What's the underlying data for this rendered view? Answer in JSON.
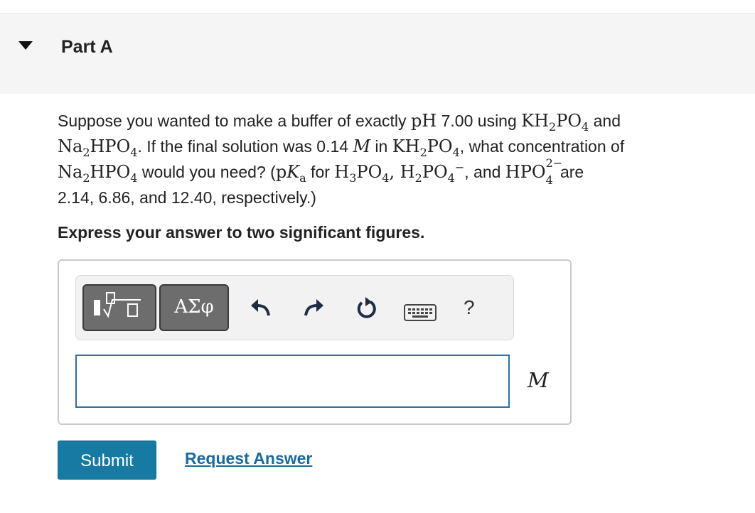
{
  "part": {
    "title": "Part A"
  },
  "question": {
    "t1": "Suppose you wanted to make a buffer of exactly ",
    "pH": "pH",
    "t2": " 7.00 using ",
    "kh2po4_a": "KH",
    "kh2po4_b": "2",
    "kh2po4_c": "PO",
    "kh2po4_d": "4",
    "t3": " and",
    "na2hpo4_a": "Na",
    "na2hpo4_b": "2",
    "na2hpo4_c": "HPO",
    "na2hpo4_d": "4",
    "t4": ". If the final solution was 0.14 ",
    "M": "M",
    "t5": " in ",
    "t6": ", what concentration of",
    "t7": " would you need? (",
    "pKa_p": "p",
    "pKa_K": "K",
    "pKa_a": "a",
    "t8": " for ",
    "h3po4_a": "H",
    "h3po4_b": "3",
    "h3po4_c": "PO",
    "h3po4_d": "4",
    "comma": ", ",
    "h2po4_a": "H",
    "h2po4_b": "2",
    "h2po4_c": "PO",
    "h2po4_d": "4",
    "minus": "−",
    "t9": ", and ",
    "hpo4_a": "HPO",
    "hpo4_sub": "4",
    "hpo4_sup": "2−",
    "t10": " are",
    "t11": "2.14, 6.86, and 12.40, respectively.)"
  },
  "instruction": "Express your answer to two significant figures.",
  "toolbar": {
    "templates_icon": "templates-icon",
    "greek_label": "ΑΣφ",
    "undo_icon": "undo-icon",
    "redo_icon": "redo-icon",
    "reset_icon": "reset-icon",
    "keyboard_icon": "keyboard-icon",
    "help_label": "?"
  },
  "answer": {
    "value": "",
    "unit": "M"
  },
  "buttons": {
    "submit": "Submit",
    "request": "Request Answer"
  },
  "colors": {
    "submit_bg": "#167aa3",
    "link": "#1b6a9a",
    "input_border": "#2f6f9e"
  }
}
